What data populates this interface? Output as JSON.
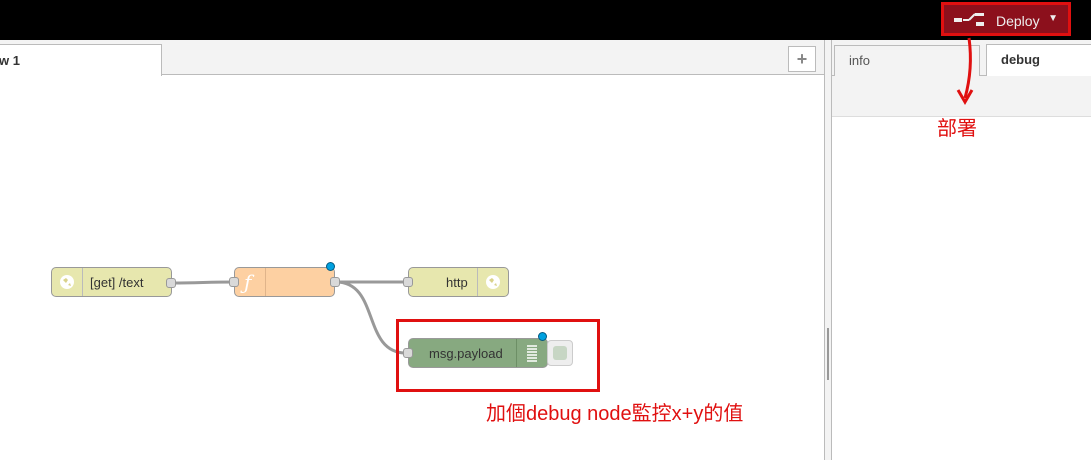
{
  "header": {
    "deploy_label": "Deploy",
    "deploy_icon": "deploy-icon",
    "caret_icon": "caret-down-icon"
  },
  "workspace": {
    "tab_label": "w 1",
    "add_tab_symbol": "+"
  },
  "sidebar": {
    "tabs": [
      {
        "label": "info"
      },
      {
        "label": "debug"
      }
    ]
  },
  "flow": {
    "nodes": [
      {
        "name": "http-in",
        "label": "[get] /text",
        "color": "#e7e7ae",
        "icon": "globe-icon"
      },
      {
        "name": "function",
        "label": "ƒ",
        "color": "#fdd0a2",
        "icon": "function-icon"
      },
      {
        "name": "http-response",
        "label": "http",
        "color": "#e7e7ae",
        "icon": "globe-icon"
      },
      {
        "name": "debug",
        "label": "msg.payload",
        "color": "#87a980",
        "icon": "list-icon"
      }
    ]
  },
  "annotations": {
    "deploy_note": "部署",
    "debug_note": "加個debug node監控x+y的值",
    "color": "#e01010"
  }
}
